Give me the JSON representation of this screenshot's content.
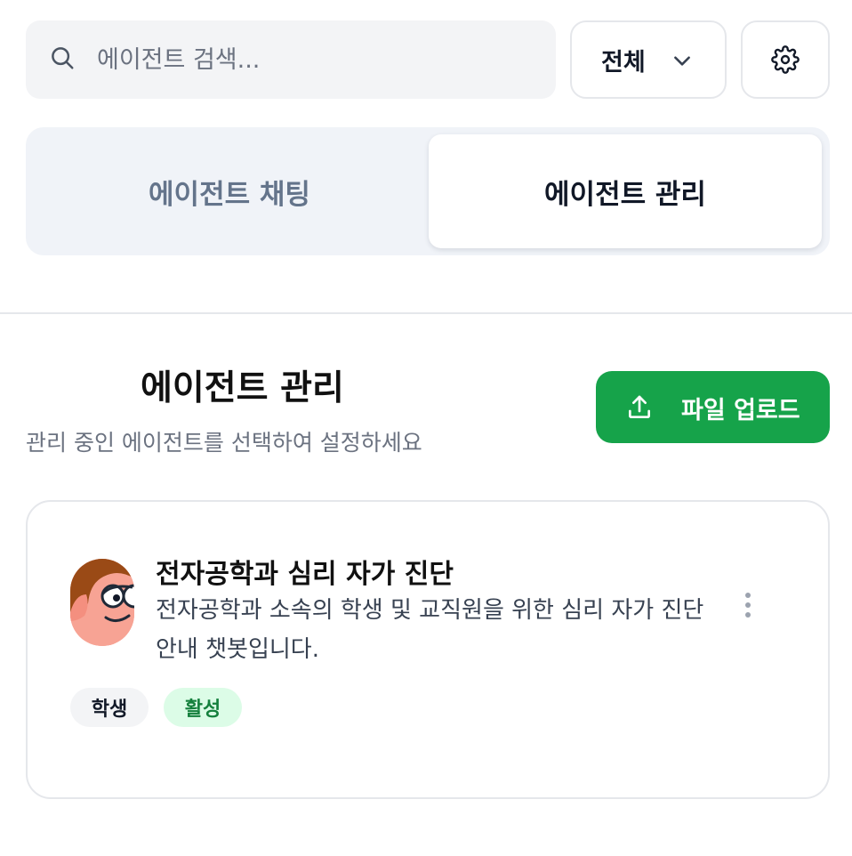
{
  "search": {
    "placeholder": "에이전트 검색..."
  },
  "filter": {
    "selected": "전체"
  },
  "tabs": [
    {
      "label": "에이전트 채팅",
      "active": false
    },
    {
      "label": "에이전트 관리",
      "active": true
    }
  ],
  "section": {
    "title": "에이전트 관리",
    "subtitle": "관리 중인 에이전트를 선택하여 설정하세요",
    "upload_label": "파일 업로드"
  },
  "agents": [
    {
      "name": "전자공학과 심리 자가 진단",
      "description": "전자공학과 소속의 학생 및 교직원을 위한 심리 자가 진단 안내 챗봇입니다.",
      "tags": [
        "학생",
        "활성"
      ]
    }
  ],
  "colors": {
    "accent_green": "#16a34a",
    "status_active_bg": "#dcfce7",
    "status_active_text": "#15803d"
  },
  "icons": {
    "search": "search-icon",
    "dropdown": "chevron-down-icon",
    "settings": "gear-icon",
    "upload": "upload-icon",
    "more": "more-vertical-icon"
  }
}
